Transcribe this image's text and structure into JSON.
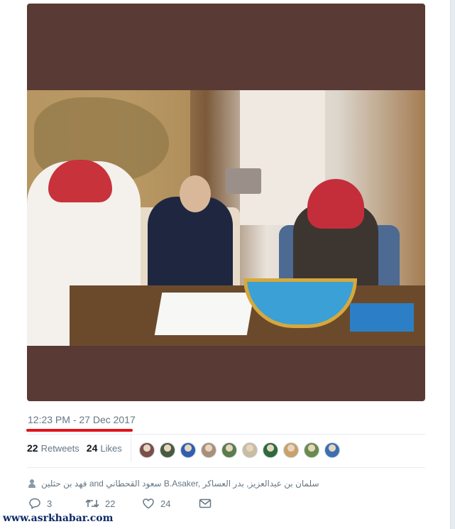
{
  "tweet": {
    "timestamp": "12:23 PM - 27 Dec 2017",
    "retweets_count": "22",
    "retweets_label": "Retweets",
    "likes_count": "24",
    "likes_label": "Likes",
    "liked_by": "فهد بن حثلين and سعود القحطاني B.Asaker, سلمان بن عبدالعزيز, بدر العساكر",
    "avatar_colors": [
      "#7a4f4a",
      "#4b5a3f",
      "#2f5fb0",
      "#a98f7c",
      "#5b7c4c",
      "#c8bca2",
      "#2e6a3c",
      "#c9a16b",
      "#6a8b4b",
      "#3d6fb0"
    ],
    "actions": {
      "reply_count": "3",
      "retweet_count": "22",
      "like_count": "24"
    }
  },
  "watermark": "www.asrkhabar.com",
  "colors": {
    "media_background": "#5a3a35",
    "underline": "#e0141b",
    "muted_text": "#657786"
  }
}
